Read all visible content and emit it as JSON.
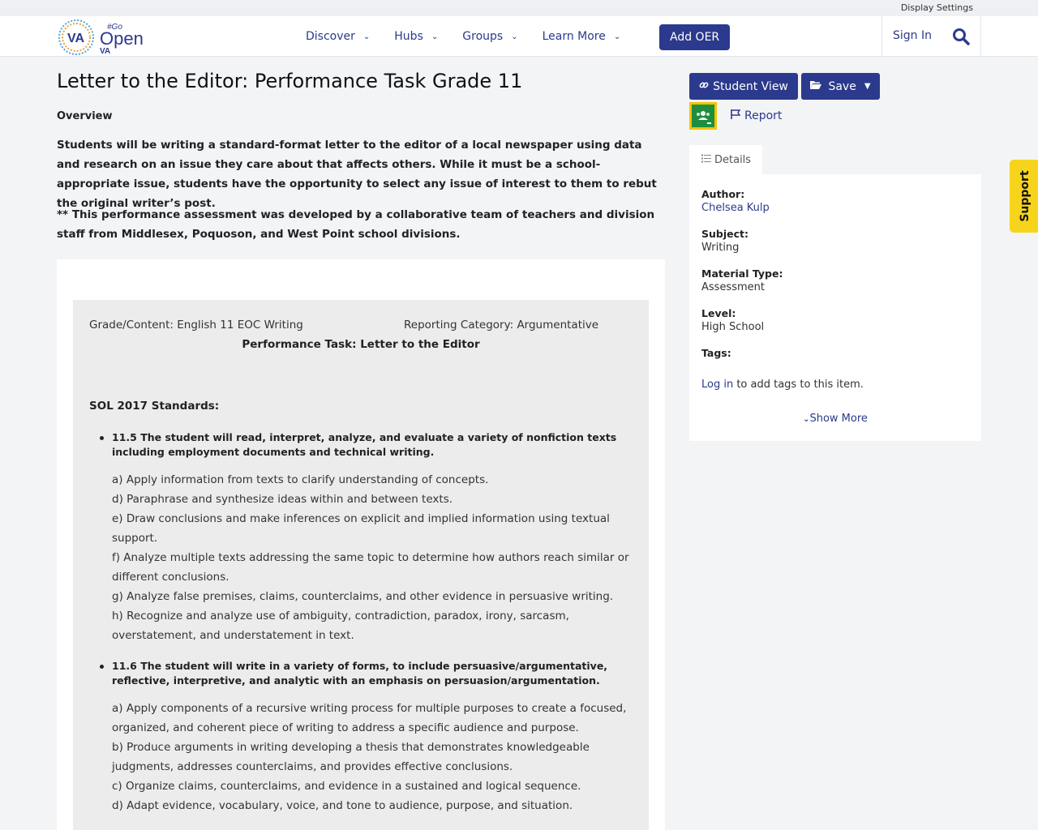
{
  "utility": {
    "display_settings": "Display Settings"
  },
  "logo": {
    "va": "VA",
    "go": "#Go",
    "open": "Open",
    "va_small": "VA"
  },
  "nav": {
    "items": [
      {
        "label": "Discover"
      },
      {
        "label": "Hubs"
      },
      {
        "label": "Groups"
      },
      {
        "label": "Learn More"
      }
    ],
    "add_oer": "Add OER",
    "sign_in": "Sign In"
  },
  "page": {
    "title": "Letter to the Editor: Performance Task Grade 11",
    "overview_label": "Overview",
    "overview_text": "Students will be writing a standard-format letter to the editor of a local newspaper using data and research on an issue they care about that affects others. While it must be a school-appropriate issue, students have the opportunity to select any issue of interest to them to rebut the original writer’s post.",
    "overview_note": "** This performance assessment was developed by a collaborative team of teachers and division staff from Middlesex, Poquoson, and West Point school divisions."
  },
  "content": {
    "grade": "Grade/Content:  English 11 EOC Writing",
    "category": "Reporting Category: Argumentative",
    "task_title": "Performance Task: Letter to the Editor",
    "sol_label": "SOL 2017 Standards:",
    "standard_1": {
      "heading": "11.5 The student will read, interpret, analyze, and evaluate a variety of nonfiction texts including employment documents and technical writing.",
      "items": [
        "a)   Apply information from texts to clarify understanding of concepts.",
        "d)   Paraphrase and synthesize ideas within and between texts.",
        "e)   Draw conclusions and make inferences on explicit and implied information using textual support.",
        "f)   Analyze multiple texts addressing the same topic to determine how authors reach similar or different conclusions.",
        "g)   Analyze false premises, claims, counterclaims, and other evidence in persuasive writing.",
        "h)   Recognize and analyze use of ambiguity, contradiction, paradox, irony, sarcasm, overstatement, and understatement in text."
      ]
    },
    "standard_2": {
      "heading": "11.6 The student will write in a variety of forms, to include persuasive/argumentative, reflective, interpretive, and analytic with an emphasis on persuasion/argumentation.",
      "items": [
        "a)   Apply components of a recursive writing process for multiple purposes to create a focused, organized, and coherent piece of writing to address a specific audience and purpose.",
        "b)   Produce arguments in writing developing a thesis that demonstrates knowledgeable judgments, addresses counterclaims, and provides effective conclusions.",
        "c)   Organize claims, counterclaims, and evidence in a sustained and logical sequence.",
        "d)   Adapt evidence, vocabulary, voice, and tone to audience, purpose, and situation."
      ]
    }
  },
  "sidebar": {
    "student_view": "Student View",
    "save": "Save",
    "report": "Report",
    "details_tab": "Details",
    "author_label": "Author:",
    "author_value": "Chelsea Kulp",
    "subject_label": "Subject:",
    "subject_value": "Writing",
    "material_label": "Material Type:",
    "material_value": "Assessment",
    "level_label": "Level:",
    "level_value": "High School",
    "tags_label": "Tags:",
    "login_link": "Log in",
    "login_rest": " to add tags to this item.",
    "show_more": "Show More",
    "support": "Support"
  },
  "colors": {
    "primary": "#2b3a8c",
    "support_tab": "#f7d41c",
    "classroom_green": "#1e8e3e",
    "classroom_border": "#f5c400"
  }
}
